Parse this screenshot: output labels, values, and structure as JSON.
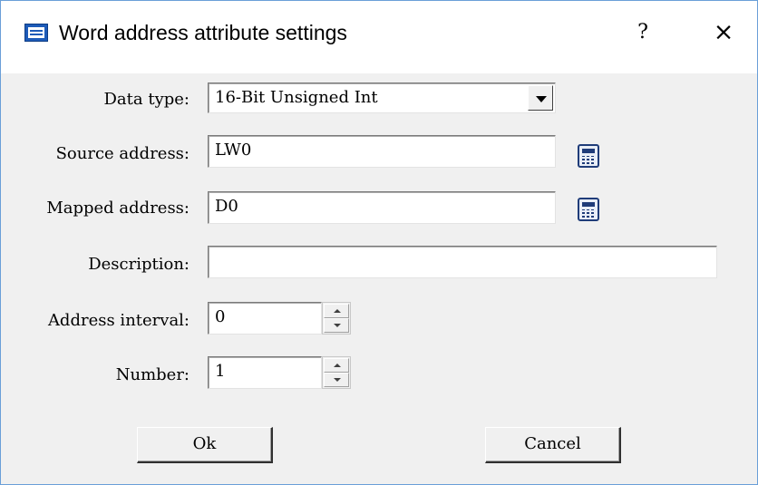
{
  "window": {
    "title": "Word address attribute settings",
    "help_label": "?",
    "close_label": "×"
  },
  "form": {
    "data_type": {
      "label": "Data type:",
      "value": "16-Bit Unsigned Int"
    },
    "source_address": {
      "label": "Source address:",
      "value": "LW0"
    },
    "mapped_address": {
      "label": "Mapped address:",
      "value": "D0"
    },
    "description": {
      "label": "Description:",
      "value": ""
    },
    "address_interval": {
      "label": "Address interval:",
      "value": "0"
    },
    "number": {
      "label": "Number:",
      "value": "1"
    }
  },
  "buttons": {
    "ok_label": "Ok",
    "cancel_label": "Cancel"
  },
  "icons": {
    "title": "hmi-app-icon",
    "help": "question-mark-icon",
    "close": "close-icon",
    "dropdown": "chevron-down-icon",
    "address_picker": "calculator-icon",
    "spin_up": "spin-up-icon",
    "spin_down": "spin-down-icon"
  },
  "colors": {
    "titlebar_bg": "#ffffff",
    "dialog_bg": "#f0f0f0",
    "window_border": "#6a9fd8",
    "icon_blue": "#1d5bb8"
  }
}
